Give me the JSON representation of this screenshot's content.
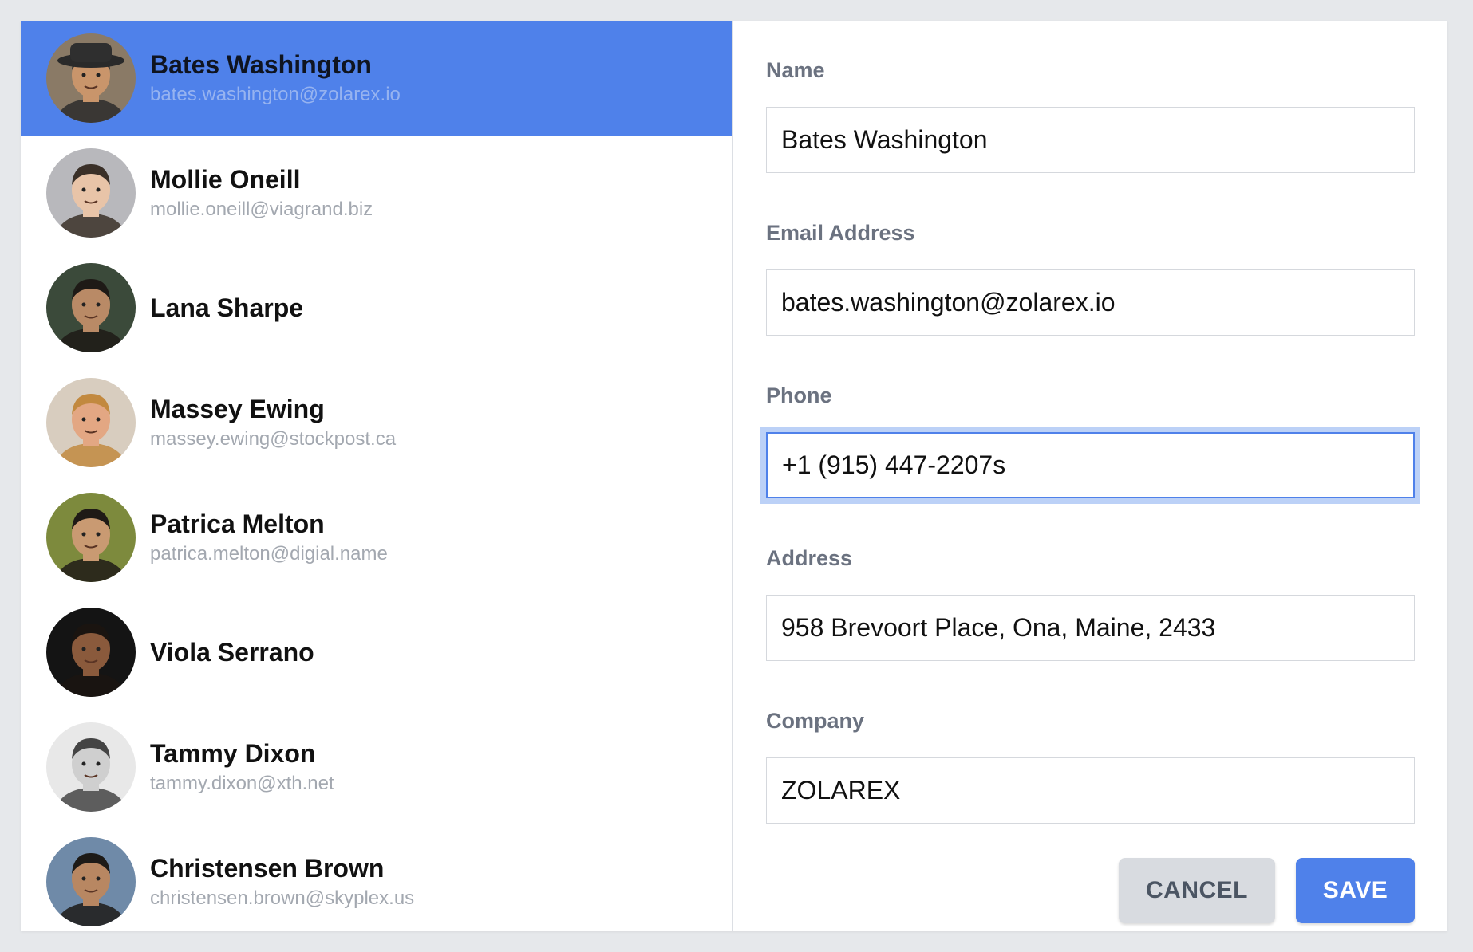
{
  "contacts": [
    {
      "name": "Bates Washington",
      "email": "bates.washington@zolarex.io",
      "selected": true,
      "skin": "#c9956b",
      "hair": "#2b2b2b",
      "bg": "#8a7a66",
      "hat": true
    },
    {
      "name": "Mollie Oneill",
      "email": "mollie.oneill@viagrand.biz",
      "selected": false,
      "skin": "#e8c4a8",
      "hair": "#3a3028",
      "bg": "#b8b8bc"
    },
    {
      "name": "Lana Sharpe",
      "email": "",
      "selected": false,
      "skin": "#b98a66",
      "hair": "#1e1a16",
      "bg": "#3b4a3a"
    },
    {
      "name": "Massey Ewing",
      "email": "massey.ewing@stockpost.ca",
      "selected": false,
      "skin": "#e3a783",
      "hair": "#c2893f",
      "bg": "#d8cdbf"
    },
    {
      "name": "Patrica Melton",
      "email": "patrica.melton@digial.name",
      "selected": false,
      "skin": "#c99a72",
      "hair": "#1f1a16",
      "bg": "#7d8a3d"
    },
    {
      "name": "Viola Serrano",
      "email": "",
      "selected": false,
      "skin": "#8a5a3c",
      "hair": "#1a1410",
      "bg": "#141414"
    },
    {
      "name": "Tammy Dixon",
      "email": "tammy.dixon@xth.net",
      "selected": false,
      "skin": "#cfcfcf",
      "hair": "#444444",
      "bg": "#e8e8e8"
    },
    {
      "name": "Christensen Brown",
      "email": "christensen.brown@skyplex.us",
      "selected": false,
      "skin": "#b88762",
      "hair": "#1d1a17",
      "bg": "#6f8aa8"
    }
  ],
  "form": {
    "name_label": "Name",
    "name_value": "Bates Washington",
    "email_label": "Email Address",
    "email_value": "bates.washington@zolarex.io",
    "phone_label": "Phone",
    "phone_value": "+1 (915) 447-2207s",
    "address_label": "Address",
    "address_value": "958 Brevoort Place, Ona, Maine, 2433",
    "company_label": "Company",
    "company_value": "ZOLAREX"
  },
  "actions": {
    "cancel_label": "CANCEL",
    "save_label": "SAVE"
  },
  "colors": {
    "accent": "#4f81ea",
    "focus_ring": "#bcd1f7"
  }
}
